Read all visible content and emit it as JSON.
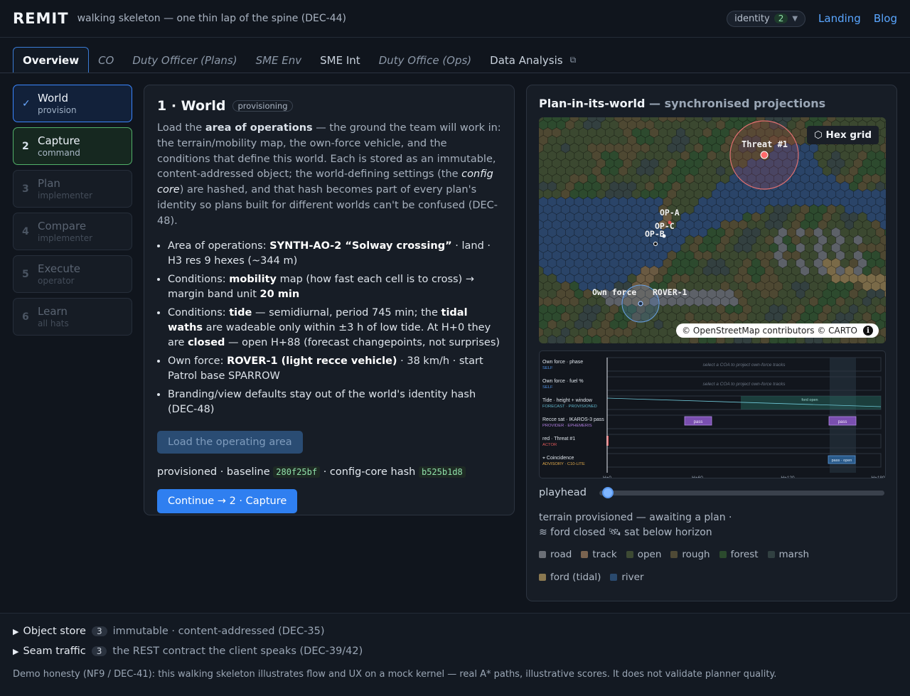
{
  "header": {
    "brand": "REMIT",
    "subtitle": "walking skeleton — one thin lap of the spine (DEC-44)",
    "identity_label": "identity",
    "identity_count": "2",
    "links": [
      "Landing",
      "Blog"
    ]
  },
  "tabs": [
    {
      "label": "Overview",
      "active": true
    },
    {
      "label": "CO"
    },
    {
      "label": "Duty Officer (Plans)"
    },
    {
      "label": "SME Env"
    },
    {
      "label": "SME Int"
    },
    {
      "label": "Duty Office (Ops)"
    },
    {
      "label": "Data Analysis"
    }
  ],
  "steps": [
    {
      "num": "✓",
      "title": "World",
      "sub": "provision",
      "state": "done"
    },
    {
      "num": "2",
      "title": "Capture",
      "sub": "command",
      "state": "current"
    },
    {
      "num": "3",
      "title": "Plan",
      "sub": "implementer",
      "state": "disabled"
    },
    {
      "num": "4",
      "title": "Compare",
      "sub": "implementer",
      "state": "disabled"
    },
    {
      "num": "5",
      "title": "Execute",
      "sub": "operator",
      "state": "disabled"
    },
    {
      "num": "6",
      "title": "Learn",
      "sub": "all hats",
      "state": "disabled"
    }
  ],
  "world": {
    "title": "1 · World",
    "chip": "provisioning",
    "intro": {
      "a": "Load the ",
      "b": "area of operations",
      "c": " — the ground the team will work in: the terrain/mobility map, the own-force vehicle, and the conditions that define this world. Each is stored as an immutable, content-addressed object; the world-defining settings (the ",
      "d": "config core",
      "e": ") are hashed, and that hash becomes part of every plan's identity so plans built for different worlds can't be confused (DEC-48)."
    },
    "bullets": {
      "aoa_pre": "Area of operations: ",
      "aoa_b": "SYNTH-AO-2 “Solway crossing”",
      "aoa_post": " · land · H3 res 9 hexes (~344 m)",
      "mob_pre": "Conditions: ",
      "mob_b": "mobility",
      "mob_mid": " map (how fast each cell is to cross) → margin band unit ",
      "mob_b2": "20 min",
      "tide_pre": "Conditions: ",
      "tide_b": "tide",
      "tide_mid": " — semidiurnal, period 745 min; the ",
      "tide_b2": "tidal waths",
      "tide_mid2": " are wadeable only within ±3 h of low tide. At H+0 they are ",
      "tide_b3": "closed",
      "tide_post": " — open H+88 (forecast changepoints, not surprises)",
      "own_pre": "Own force: ",
      "own_b": "ROVER-1 (light recce vehicle)",
      "own_post": " · 38 km/h · start Patrol base SPARROW",
      "brand": "Branding/view defaults stay out of the world's identity hash (DEC-48)"
    },
    "load_button": "Load the operating area",
    "prov_a": "provisioned · baseline",
    "baseline_hash": "280f25bf",
    "prov_b": "· config-core hash",
    "core_hash": "b525b1d8",
    "continue_button": "Continue → 2 · Capture"
  },
  "plan_panel": {
    "title": "Plan-in-its-world",
    "title_suffix": " — synchronised projections",
    "map": {
      "hex_button": "⬡ Hex grid",
      "labels": {
        "threat": "Threat #1",
        "opa": "OP-A",
        "opc": "OP-C",
        "opb": "OP-B",
        "own": "Own force",
        "rover": "ROVER-1"
      },
      "attribution": "© OpenStreetMap contributors © CARTO"
    },
    "timeline": {
      "rows": [
        {
          "name": "Own force · phase",
          "tag": "SELF",
          "tag_color": "#4f8fe0",
          "note": "select a COA to project own-force tracks"
        },
        {
          "name": "Own force · fuel %",
          "tag": "SELF",
          "tag_color": "#4f8fe0",
          "note": "select a COA to project own-force tracks"
        },
        {
          "name": "Tide · height + window",
          "tag": "FORECAST · PROVISIONED",
          "tag_color": "#5fb3c8",
          "note": "ford open"
        },
        {
          "name": "Recce sat · IKAROS-3 pass",
          "tag": "PROVIDER · EPHEMERIS",
          "tag_color": "#b07de0",
          "note": "pass"
        },
        {
          "name": "red · Threat #1",
          "tag": "ACTOR",
          "tag_color": "#e05a5a",
          "note": ""
        },
        {
          "name": "⌖ Coincidence",
          "tag": "ADVISORY · C10-LITE",
          "tag_color": "#e0a94a",
          "note": "pass · open"
        }
      ],
      "ticks": [
        "H+0",
        "H+60",
        "H+120",
        "H+180"
      ]
    },
    "playhead_label": "playhead",
    "status_line1": "terrain provisioned — awaiting a plan ·",
    "status_line2": "≋ ford closed 🛰 sat below horizon",
    "legend": [
      {
        "label": "road",
        "color": "#6b6f76"
      },
      {
        "label": "track",
        "color": "#7a6450"
      },
      {
        "label": "open",
        "color": "#3d4a33"
      },
      {
        "label": "rough",
        "color": "#4f4a36"
      },
      {
        "label": "forest",
        "color": "#2b4a2d"
      },
      {
        "label": "marsh",
        "color": "#314041"
      },
      {
        "label": "ford (tidal)",
        "color": "#8a7850"
      },
      {
        "label": "river",
        "color": "#2a4a6e"
      }
    ]
  },
  "footer": {
    "store_label": "Object store",
    "store_count": "3",
    "store_desc": "immutable · content-addressed (DEC-35)",
    "seam_label": "Seam traffic",
    "seam_count": "3",
    "seam_desc": "the REST contract the client speaks (DEC-39/42)",
    "honesty": "Demo honesty (NF9 / DEC-41): this walking skeleton illustrates flow and UX on a mock kernel — real A* paths, illustrative scores. It does not validate planner quality."
  }
}
